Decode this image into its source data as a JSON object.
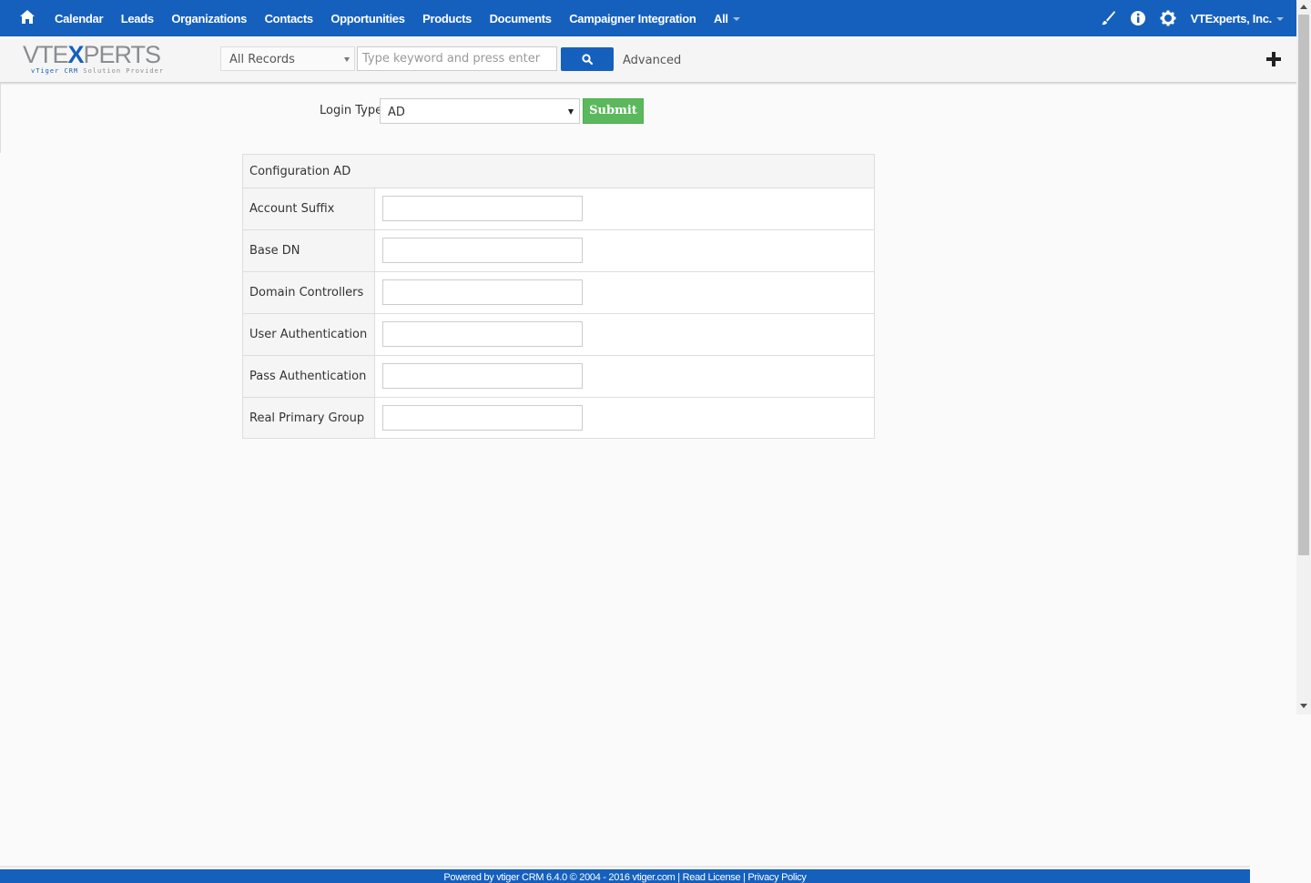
{
  "nav": {
    "items": [
      {
        "label": "Calendar"
      },
      {
        "label": "Leads"
      },
      {
        "label": "Organizations"
      },
      {
        "label": "Contacts"
      },
      {
        "label": "Opportunities"
      },
      {
        "label": "Products"
      },
      {
        "label": "Documents"
      },
      {
        "label": "Campaigner Integration"
      },
      {
        "label": "All"
      }
    ],
    "user": "VTExperts, Inc."
  },
  "logo": {
    "part1": "VTE",
    "x": "X",
    "part2": "PERTS",
    "tagline_a": "vTiger CRM ",
    "tagline_b": "Solution Provider"
  },
  "search": {
    "scope": "All Records",
    "placeholder": "Type keyword and press enter",
    "advanced": "Advanced"
  },
  "login": {
    "label": "Login Type",
    "value": "AD",
    "submit": "Submit"
  },
  "config": {
    "title": "Configuration AD",
    "fields": [
      {
        "label": "Account Suffix",
        "value": ""
      },
      {
        "label": "Base DN",
        "value": ""
      },
      {
        "label": "Domain Controllers",
        "value": ""
      },
      {
        "label": "User Authentication",
        "value": ""
      },
      {
        "label": "Pass Authentication",
        "value": ""
      },
      {
        "label": "Real Primary Group",
        "value": ""
      }
    ]
  },
  "footer": {
    "text": "Powered by vtiger CRM 6.4.0  © 2004 - 2016  vtiger.com | Read License | Privacy Policy"
  },
  "colors": {
    "brand": "#1560bd",
    "submit": "#5cb85c"
  }
}
